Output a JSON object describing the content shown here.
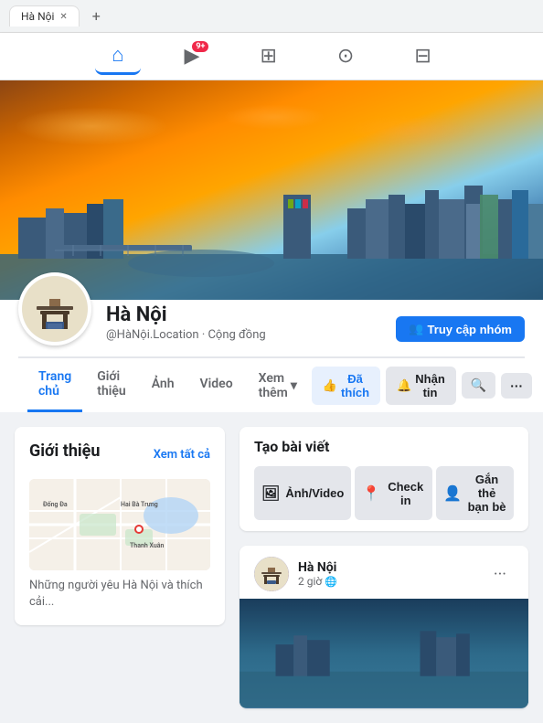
{
  "browser": {
    "tab_label": "Hà Nội",
    "new_tab": "+"
  },
  "nav": {
    "home_icon": "🏠",
    "video_icon": "📺",
    "notification": "9+",
    "store_icon": "🏪",
    "people_icon": "👥",
    "menu_icon": "☰"
  },
  "profile": {
    "name": "Hà Nội",
    "username": "@HàNội.Location",
    "type": "Cộng đồng",
    "sub_text": "@HàNội.Location · Cộng đồng",
    "join_button": "Truy cập nhóm",
    "join_icon": "👥"
  },
  "tabs": {
    "items": [
      {
        "label": "Trang chủ",
        "active": true
      },
      {
        "label": "Giới thiệu",
        "active": false
      },
      {
        "label": "Ảnh",
        "active": false
      },
      {
        "label": "Video",
        "active": false
      },
      {
        "label": "Xem thêm",
        "active": false
      }
    ],
    "liked_button": "Đã thích",
    "following_button": "Nhận tin",
    "liked_icon": "👍",
    "following_icon": "🔔",
    "search_icon": "🔍",
    "more_icon": "···"
  },
  "intro": {
    "title": "Giới thiệu",
    "see_all": "Xem tất cả",
    "about_text": "Những người yêu Hà Nội và thích cải..."
  },
  "map": {
    "labels": [
      "Đống Đa",
      "Hai Bà Trưng",
      "Thanh Xuân"
    ]
  },
  "create_post": {
    "title": "Tạo bài viết",
    "photo_video": "Ảnh/Video",
    "check_in": "Check in",
    "tag_friends": "Gắn thẻ bạn bè",
    "photo_icon": "🖼",
    "checkin_icon": "📍",
    "tag_icon": "👤"
  },
  "post": {
    "author": "Hà Nội",
    "time": "2 giờ",
    "globe": "🌐",
    "more": "···"
  }
}
